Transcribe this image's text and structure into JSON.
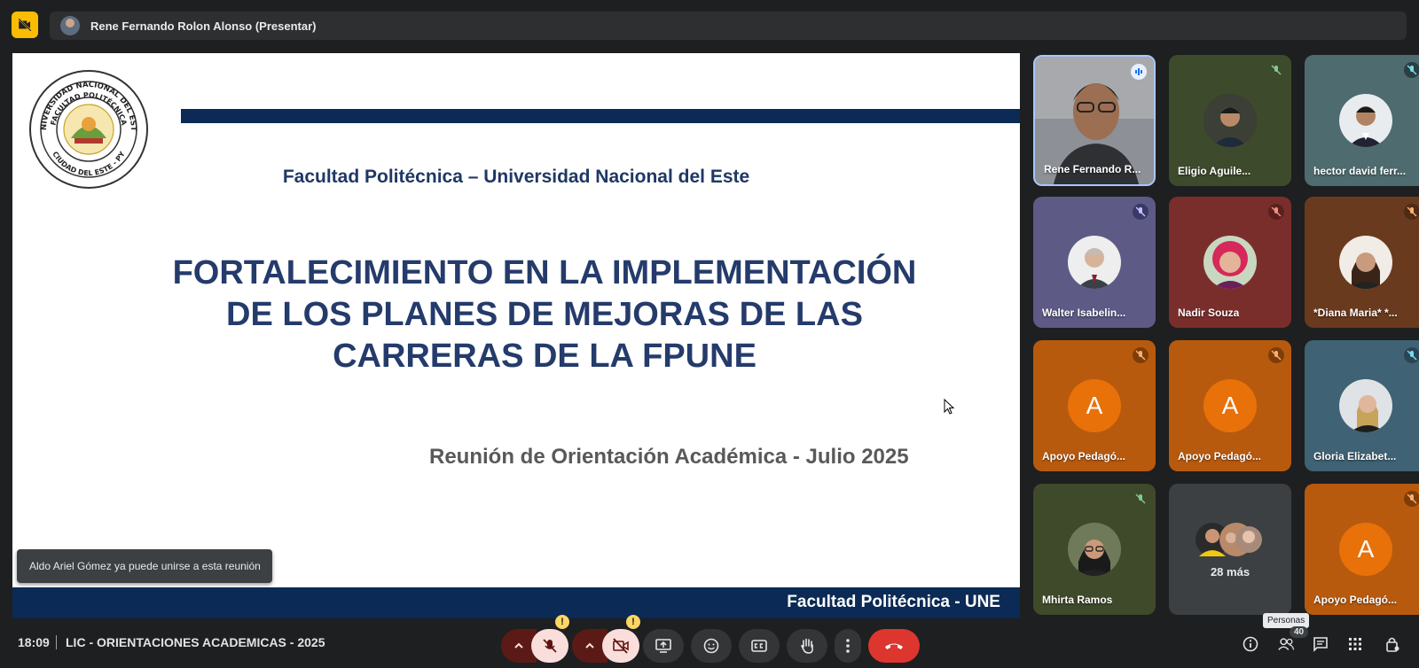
{
  "topbar": {
    "presenter_label": "Rene Fernando Rolon Alonso (Presentar)"
  },
  "slide": {
    "seal_top_text": "UNIVERSIDAD NACIONAL DEL ESTE",
    "seal_mid_text": "FACULTAD POLITÉCNICA",
    "seal_bottom_text": "CIUDAD DEL ESTE - PY",
    "subtitle": "Facultad Politécnica – Universidad Nacional del Este",
    "title_lines": [
      "FORTALECIMIENTO EN LA IMPLEMENTACIÓN",
      "DE LOS PLANES DE MEJORAS DE LAS",
      "CARRERAS DE LA FPUNE"
    ],
    "meeting": "Reunión de Orientación Académica - Julio 2025",
    "footer": "Facultad Politécnica - UNE"
  },
  "toast": "Aldo Ariel Gómez ya puede unirse a esta reunión",
  "participants": [
    {
      "name": "Rene Fernando R...",
      "bg": "#7a7f86"
    },
    {
      "name": "Eligio Aguile...",
      "bg": "#3d4a2c"
    },
    {
      "name": "hector david ferr...",
      "bg": "#4e6b6f"
    },
    {
      "name": "Walter Isabelin...",
      "bg": "#5d5a86"
    },
    {
      "name": "Nadir Souza",
      "bg": "#7a2e2b"
    },
    {
      "name": "*Diana Maria* *...",
      "bg": "#6a3a1e"
    },
    {
      "name": "Apoyo Pedagó...",
      "bg": "#b85a0e",
      "letter": "A"
    },
    {
      "name": "Apoyo Pedagó...",
      "bg": "#b85a0e",
      "letter": "A"
    },
    {
      "name": "Gloria Elizabet...",
      "bg": "#3f6274"
    },
    {
      "name": "Mhirta Ramos",
      "bg": "#3f4a2a"
    },
    {
      "name": "28 más",
      "bg": "#3c4043"
    },
    {
      "name": "Apoyo Pedagó...",
      "bg": "#b85a0e",
      "letter": "A"
    }
  ],
  "controls": {
    "time": "18:09",
    "meeting_name": "LIC - ORIENTACIONES ACADEMICAS - 2025",
    "warn_mark": "!",
    "people_tooltip": "Personas",
    "people_count": "40"
  }
}
